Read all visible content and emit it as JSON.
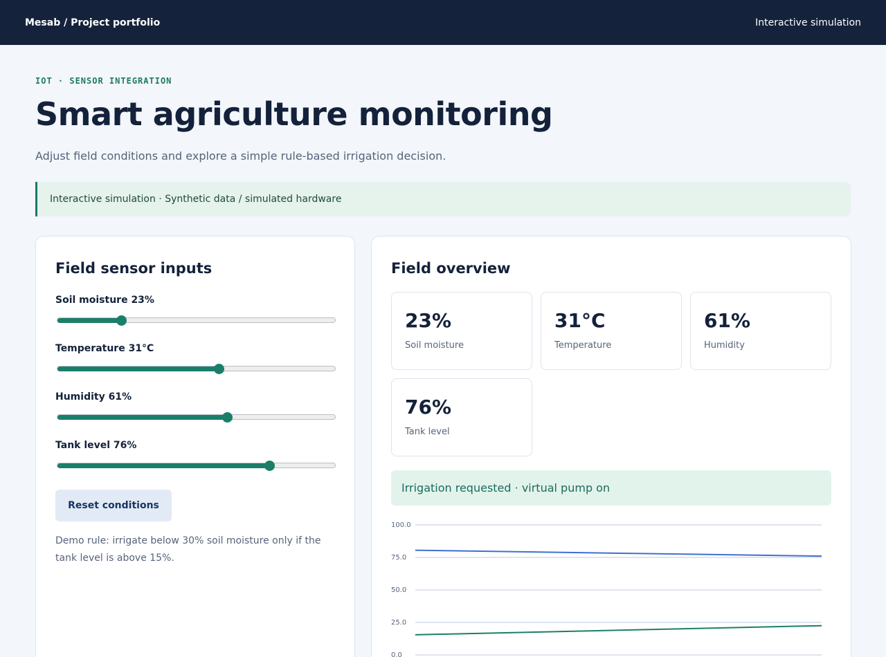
{
  "header": {
    "brand": "Mesab / Project portfolio",
    "right_label": "Interactive simulation"
  },
  "hero": {
    "eyebrow": "IOT · SENSOR INTEGRATION",
    "title": "Smart agriculture monitoring",
    "subtitle": "Adjust field conditions and explore a simple rule-based irrigation decision."
  },
  "banner": {
    "text": "Interactive simulation · Synthetic data / simulated hardware"
  },
  "inputs": {
    "title": "Field sensor inputs",
    "sliders": [
      {
        "label": "Soil moisture 23%",
        "value": 0.23
      },
      {
        "label": "Temperature 31°C",
        "value": 0.58
      },
      {
        "label": "Humidity 61%",
        "value": 0.61
      },
      {
        "label": "Tank level 76%",
        "value": 0.76
      }
    ],
    "reset_label": "Reset conditions",
    "rule_note": "Demo rule: irrigate below 30% soil moisture only if the tank level is above 15%."
  },
  "overview": {
    "title": "Field overview",
    "metrics": [
      {
        "value": "23%",
        "label": "Soil moisture"
      },
      {
        "value": "31°C",
        "label": "Temperature"
      },
      {
        "value": "61%",
        "label": "Humidity"
      },
      {
        "value": "76%",
        "label": "Tank level"
      }
    ],
    "status": "Irrigation requested · virtual pump on"
  },
  "colors": {
    "accent": "#1b7a67",
    "header_bg": "#14233b",
    "series_blue": "#3f6fcf",
    "series_green": "#1b7f68"
  },
  "chart_data": {
    "type": "line",
    "ylim": [
      0,
      100
    ],
    "yticks": [
      "100.0",
      "75.0",
      "50.0",
      "25.0",
      "0.0"
    ],
    "grid": true,
    "series": [
      {
        "values": [
          80.5,
          76
        ],
        "color": "#3f6fcf"
      },
      {
        "values": [
          15.5,
          22.5
        ],
        "color": "#1b7f68"
      }
    ]
  }
}
